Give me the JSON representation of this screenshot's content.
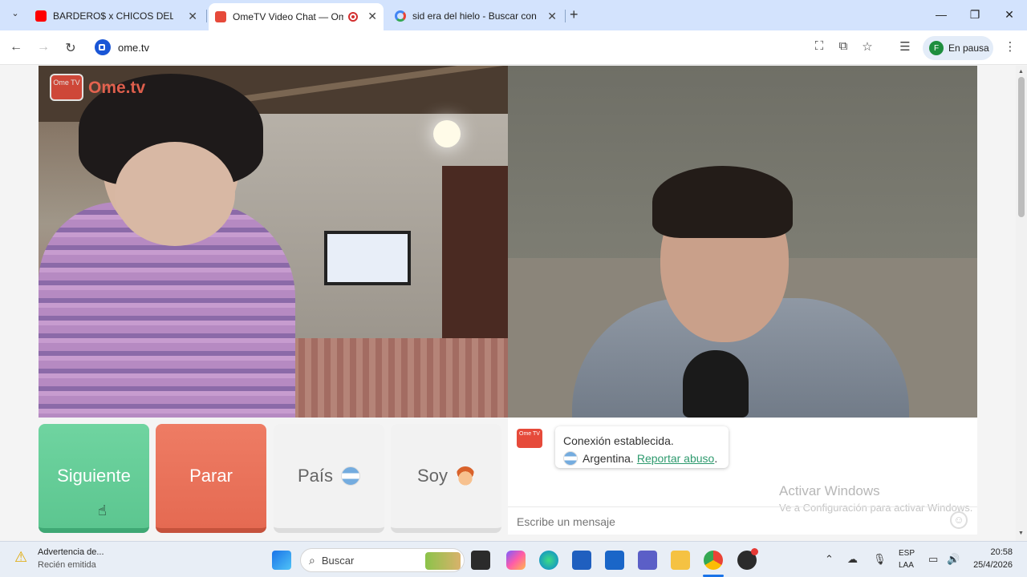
{
  "browser": {
    "tabs": [
      {
        "title": "BARDERO$ x CHICOS DEL BARR",
        "favicon": "youtube-icon",
        "active": false
      },
      {
        "title": "OmeTV Video Chat — Ome",
        "favicon": "ometv-icon",
        "active": true
      },
      {
        "title": "sid era del hielo - Buscar con Go",
        "favicon": "google-icon",
        "active": false
      }
    ],
    "new_tab_label": "+",
    "address": "ome.tv",
    "profile_initial": "F",
    "profile_status": "En pausa"
  },
  "ometv": {
    "logo_text": "Ome.tv",
    "logo_badge": "Ome TV",
    "buttons": {
      "next": "Siguiente",
      "stop": "Parar",
      "country": "País",
      "gender": "Soy"
    },
    "chat": {
      "status": "Conexión establecida.",
      "country": "Argentina.",
      "report_link": "Reportar abuso",
      "report_suffix": ".",
      "placeholder": "Escribe un mensaje",
      "logo_text": "Ome TV"
    },
    "watermark": {
      "line1": "Activar Windows",
      "line2": "Ve a Configuración para activar Windows."
    }
  },
  "taskbar": {
    "notification_title": "Advertencia de...",
    "notification_sub": "Recién emitida",
    "search_placeholder": "Buscar",
    "lang_top": "ESP",
    "lang_bottom": "LAA",
    "time": "20:58",
    "date": "25/4/2026"
  },
  "colors": {
    "next": "#5cc690",
    "stop": "#e56a52",
    "tabstrip": "#d3e3fd",
    "link": "#2e9a6e"
  }
}
